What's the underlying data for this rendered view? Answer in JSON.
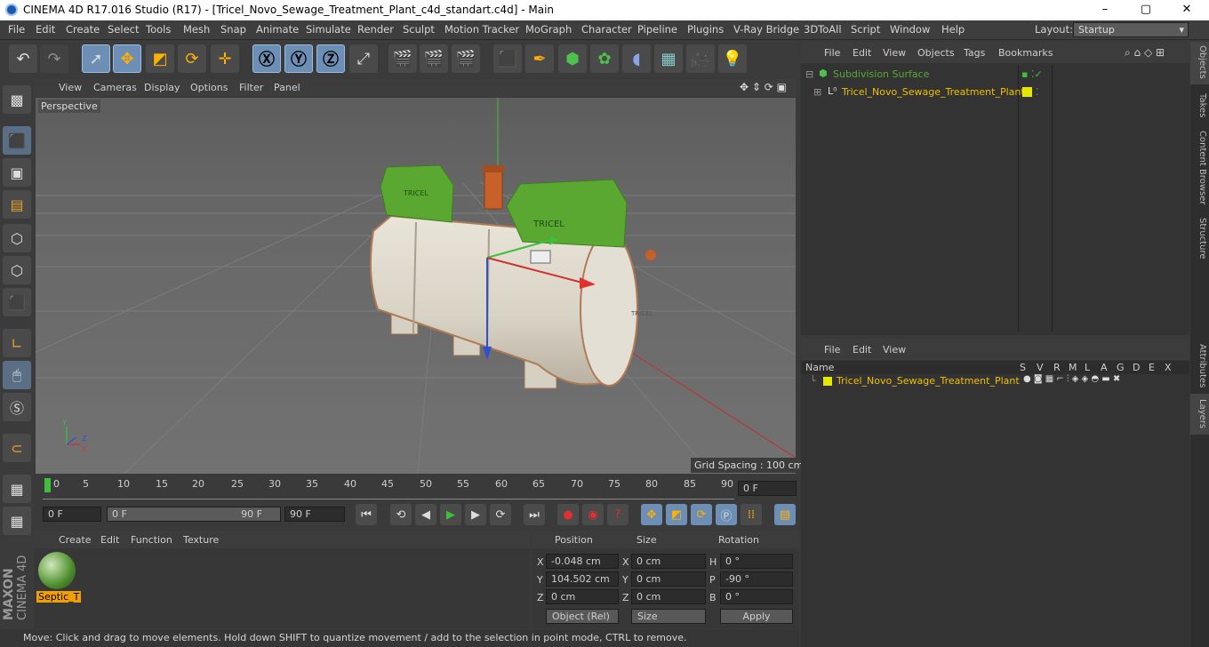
{
  "title": "CINEMA 4D R17.016 Studio (R17) - [Tricel_Novo_Sewage_Treatment_Plant_c4d_standart.c4d] - Main",
  "menu": [
    "File",
    "Edit",
    "Create",
    "Select",
    "Tools",
    "Mesh",
    "Snap",
    "Animate",
    "Simulate",
    "Render",
    "Sculpt",
    "Motion Tracker",
    "MoGraph",
    "Character",
    "Pipeline",
    "Plugins",
    "V-Ray Bridge",
    "3DToAll",
    "Script",
    "Window",
    "Help"
  ],
  "layout": {
    "label": "Layout:",
    "value": "Startup"
  },
  "viewport": {
    "menu": [
      "View",
      "Cameras",
      "Display",
      "Options",
      "Filter",
      "Panel"
    ],
    "label": "Perspective",
    "grid": "Grid Spacing : 100 cm"
  },
  "timeline": {
    "ticks": [
      "0",
      "5",
      "10",
      "15",
      "20",
      "25",
      "30",
      "35",
      "40",
      "45",
      "50",
      "55",
      "60",
      "65",
      "70",
      "75",
      "80",
      "85",
      "90"
    ],
    "end": "0 F",
    "start": "0 F",
    "range_start": "0 F",
    "range_end": "90 F",
    "max": "90 F"
  },
  "materials": {
    "menu": [
      "Create",
      "Edit",
      "Function",
      "Texture"
    ],
    "item": "Septic_T"
  },
  "coords": {
    "headers": [
      "Position",
      "Size",
      "Rotation"
    ],
    "pos": [
      [
        "X",
        "-0.048 cm"
      ],
      [
        "Y",
        "104.502 cm"
      ],
      [
        "Z",
        "0 cm"
      ]
    ],
    "size": [
      [
        "X",
        "0 cm"
      ],
      [
        "Y",
        "0 cm"
      ],
      [
        "Z",
        "0 cm"
      ]
    ],
    "rot": [
      [
        "H",
        "0 °"
      ],
      [
        "P",
        "-90 °"
      ],
      [
        "B",
        "0 °"
      ]
    ],
    "mode": "Object (Rel)",
    "sizemode": "Size",
    "apply": "Apply"
  },
  "status": "Move: Click and drag to move elements. Hold down SHIFT to quantize movement / add to the selection in point mode, CTRL to remove.",
  "objects": {
    "menu": [
      "File",
      "Edit",
      "View",
      "Objects",
      "Tags",
      "Bookmarks"
    ],
    "items": [
      "Subdivision Surface",
      "Tricel_Novo_Sewage_Treatment_Plant"
    ]
  },
  "layers": {
    "menu": [
      "File",
      "Edit",
      "View"
    ],
    "name_header": "Name",
    "cols": [
      "S",
      "V",
      "R",
      "M",
      "L",
      "A",
      "G",
      "D",
      "E",
      "X"
    ],
    "item": "Tricel_Novo_Sewage_Treatment_Plant"
  },
  "sidetabs": [
    "Objects",
    "Takes",
    "Content Browser",
    "Structure",
    "Attributes",
    "Layers"
  ],
  "brand": {
    "a": "MAXON",
    "b": "CINEMA 4D"
  },
  "model": {
    "label1": "TRICEL",
    "label2": "TRICEL",
    "label3": "TRICEL"
  }
}
